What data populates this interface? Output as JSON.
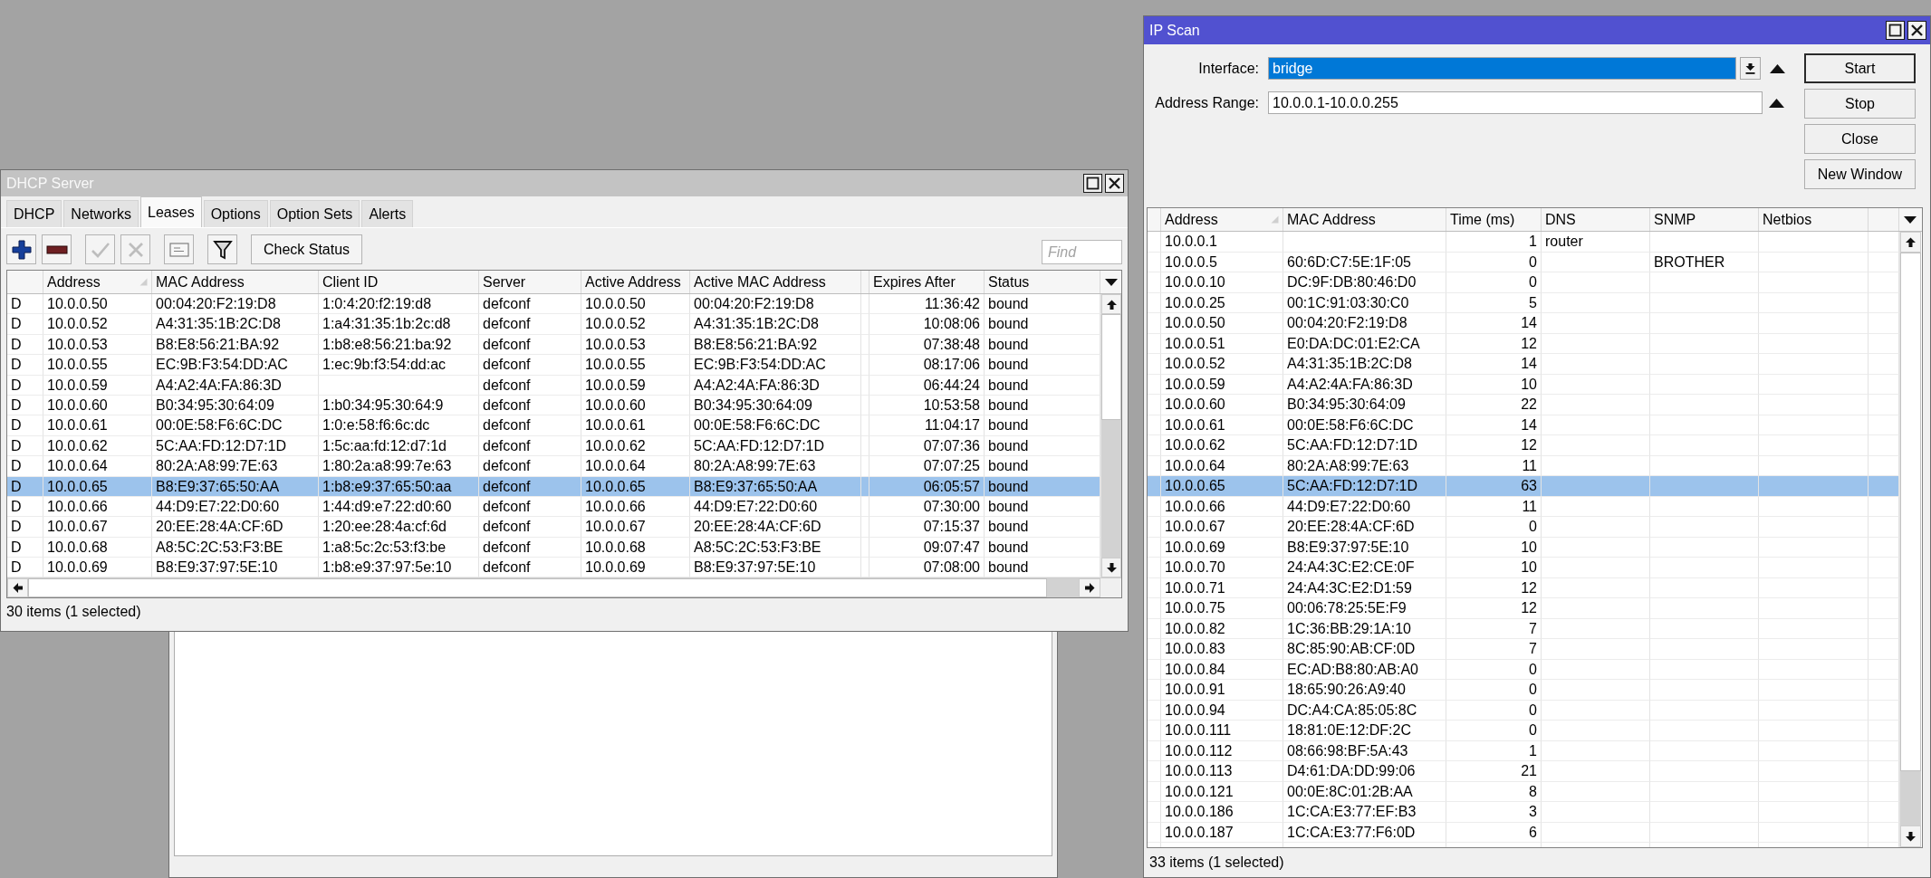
{
  "dhcp_window": {
    "title": "DHCP Server",
    "active": false,
    "tabs": [
      {
        "label": "DHCP",
        "selected": false
      },
      {
        "label": "Networks",
        "selected": false
      },
      {
        "label": "Leases",
        "selected": true
      },
      {
        "label": "Options",
        "selected": false
      },
      {
        "label": "Option Sets",
        "selected": false
      },
      {
        "label": "Alerts",
        "selected": false
      }
    ],
    "toolbar": [
      {
        "kind": "add",
        "disabled": false
      },
      {
        "kind": "remove",
        "disabled": false
      },
      {
        "kind": "enable",
        "disabled": true
      },
      {
        "kind": "disable",
        "disabled": true
      },
      {
        "kind": "comment",
        "disabled": false
      },
      {
        "kind": "filter",
        "disabled": false
      },
      {
        "kind": "text",
        "label": "Check Status",
        "disabled": false
      }
    ],
    "find": {
      "placeholder": "Find"
    },
    "table": {
      "columns": [
        {
          "label": "Address",
          "sorted": true
        },
        {
          "label": "MAC Address",
          "sorted": false
        },
        {
          "label": "Client ID",
          "sorted": false
        },
        {
          "label": "Server",
          "sorted": false
        },
        {
          "label": "Active Address",
          "sorted": false
        },
        {
          "label": "Active MAC Address",
          "sorted": false
        },
        {
          "label": "Expires After",
          "sorted": false
        },
        {
          "label": "Status",
          "sorted": false
        }
      ],
      "rows": [
        {
          "flag": "D",
          "address": "10.0.0.50",
          "mac_address": "00:04:20:F2:19:D8",
          "client_id": "1:0:4:20:f2:19:d8",
          "server": "defconf",
          "active_address": "10.0.0.50",
          "active_mac_address": "00:04:20:F2:19:D8",
          "expires_after": "11:36:42",
          "status": "bound",
          "selected": false
        },
        {
          "flag": "D",
          "address": "10.0.0.52",
          "mac_address": "A4:31:35:1B:2C:D8",
          "client_id": "1:a4:31:35:1b:2c:d8",
          "server": "defconf",
          "active_address": "10.0.0.52",
          "active_mac_address": "A4:31:35:1B:2C:D8",
          "expires_after": "10:08:06",
          "status": "bound",
          "selected": false
        },
        {
          "flag": "D",
          "address": "10.0.0.53",
          "mac_address": "B8:E8:56:21:BA:92",
          "client_id": "1:b8:e8:56:21:ba:92",
          "server": "defconf",
          "active_address": "10.0.0.53",
          "active_mac_address": "B8:E8:56:21:BA:92",
          "expires_after": "07:38:48",
          "status": "bound",
          "selected": false
        },
        {
          "flag": "D",
          "address": "10.0.0.55",
          "mac_address": "EC:9B:F3:54:DD:AC",
          "client_id": "1:ec:9b:f3:54:dd:ac",
          "server": "defconf",
          "active_address": "10.0.0.55",
          "active_mac_address": "EC:9B:F3:54:DD:AC",
          "expires_after": "08:17:06",
          "status": "bound",
          "selected": false
        },
        {
          "flag": "D",
          "address": "10.0.0.59",
          "mac_address": "A4:A2:4A:FA:86:3D",
          "server": "defconf",
          "active_address": "10.0.0.59",
          "active_mac_address": "A4:A2:4A:FA:86:3D",
          "expires_after": "06:44:24",
          "status": "bound",
          "selected": false
        },
        {
          "flag": "D",
          "address": "10.0.0.60",
          "mac_address": "B0:34:95:30:64:09",
          "client_id": "1:b0:34:95:30:64:9",
          "server": "defconf",
          "active_address": "10.0.0.60",
          "active_mac_address": "B0:34:95:30:64:09",
          "expires_after": "10:53:58",
          "status": "bound",
          "selected": false
        },
        {
          "flag": "D",
          "address": "10.0.0.61",
          "mac_address": "00:0E:58:F6:6C:DC",
          "client_id": "1:0:e:58:f6:6c:dc",
          "server": "defconf",
          "active_address": "10.0.0.61",
          "active_mac_address": "00:0E:58:F6:6C:DC",
          "expires_after": "11:04:17",
          "status": "bound",
          "selected": false
        },
        {
          "flag": "D",
          "address": "10.0.0.62",
          "mac_address": "5C:AA:FD:12:D7:1D",
          "client_id": "1:5c:aa:fd:12:d7:1d",
          "server": "defconf",
          "active_address": "10.0.0.62",
          "active_mac_address": "5C:AA:FD:12:D7:1D",
          "expires_after": "07:07:36",
          "status": "bound",
          "selected": false
        },
        {
          "flag": "D",
          "address": "10.0.0.64",
          "mac_address": "80:2A:A8:99:7E:63",
          "client_id": "1:80:2a:a8:99:7e:63",
          "server": "defconf",
          "active_address": "10.0.0.64",
          "active_mac_address": "80:2A:A8:99:7E:63",
          "expires_after": "07:07:25",
          "status": "bound",
          "selected": false
        },
        {
          "flag": "D",
          "address": "10.0.0.65",
          "mac_address": "B8:E9:37:65:50:AA",
          "client_id": "1:b8:e9:37:65:50:aa",
          "server": "defconf",
          "active_address": "10.0.0.65",
          "active_mac_address": "B8:E9:37:65:50:AA",
          "expires_after": "06:05:57",
          "status": "bound",
          "selected": true
        },
        {
          "flag": "D",
          "address": "10.0.0.66",
          "mac_address": "44:D9:E7:22:D0:60",
          "client_id": "1:44:d9:e7:22:d0:60",
          "server": "defconf",
          "active_address": "10.0.0.66",
          "active_mac_address": "44:D9:E7:22:D0:60",
          "expires_after": "07:30:00",
          "status": "bound",
          "selected": false
        },
        {
          "flag": "D",
          "address": "10.0.0.67",
          "mac_address": "20:EE:28:4A:CF:6D",
          "client_id": "1:20:ee:28:4a:cf:6d",
          "server": "defconf",
          "active_address": "10.0.0.67",
          "active_mac_address": "20:EE:28:4A:CF:6D",
          "expires_after": "07:15:37",
          "status": "bound",
          "selected": false
        },
        {
          "flag": "D",
          "address": "10.0.0.68",
          "mac_address": "A8:5C:2C:53:F3:BE",
          "client_id": "1:a8:5c:2c:53:f3:be",
          "server": "defconf",
          "active_address": "10.0.0.68",
          "active_mac_address": "A8:5C:2C:53:F3:BE",
          "expires_after": "09:07:47",
          "status": "bound",
          "selected": false
        },
        {
          "flag": "D",
          "address": "10.0.0.69",
          "mac_address": "B8:E9:37:97:5E:10",
          "client_id": "1:b8:e9:37:97:5e:10",
          "server": "defconf",
          "active_address": "10.0.0.69",
          "active_mac_address": "B8:E9:37:97:5E:10",
          "expires_after": "07:08:00",
          "status": "bound",
          "selected": false
        }
      ]
    },
    "status_bar": "30 items (1 selected)"
  },
  "ip_scan_window": {
    "title": "IP Scan",
    "active": true,
    "interface": {
      "label": "Interface:",
      "value": "bridge",
      "highlighted": true
    },
    "address_range": {
      "label": "Address Range:",
      "value": "10.0.0.1-10.0.0.255"
    },
    "buttons": [
      {
        "label": "Start",
        "default": true
      },
      {
        "label": "Stop",
        "default": false
      },
      {
        "label": "Close",
        "default": false
      },
      {
        "label": "New Window",
        "default": false
      }
    ],
    "table": {
      "columns": [
        {
          "label": "Address",
          "sorted": true
        },
        {
          "label": "MAC Address",
          "sorted": false
        },
        {
          "label": "Time (ms)",
          "sorted": false
        },
        {
          "label": "DNS",
          "sorted": false
        },
        {
          "label": "SNMP",
          "sorted": false
        },
        {
          "label": "Netbios",
          "sorted": false
        }
      ],
      "rows": [
        {
          "address": "10.0.0.1",
          "time_ms": "1",
          "dns": "router",
          "selected": false
        },
        {
          "address": "10.0.0.5",
          "mac_address": "60:6D:C7:5E:1F:05",
          "time_ms": "0",
          "snmp": "BROTHER",
          "selected": false
        },
        {
          "address": "10.0.0.10",
          "mac_address": "DC:9F:DB:80:46:D0",
          "time_ms": "0",
          "selected": false
        },
        {
          "address": "10.0.0.25",
          "mac_address": "00:1C:91:03:30:C0",
          "time_ms": "5",
          "selected": false
        },
        {
          "address": "10.0.0.50",
          "mac_address": "00:04:20:F2:19:D8",
          "time_ms": "14",
          "selected": false
        },
        {
          "address": "10.0.0.51",
          "mac_address": "E0:DA:DC:01:E2:CA",
          "time_ms": "12",
          "selected": false
        },
        {
          "address": "10.0.0.52",
          "mac_address": "A4:31:35:1B:2C:D8",
          "time_ms": "14",
          "selected": false
        },
        {
          "address": "10.0.0.59",
          "mac_address": "A4:A2:4A:FA:86:3D",
          "time_ms": "10",
          "selected": false
        },
        {
          "address": "10.0.0.60",
          "mac_address": "B0:34:95:30:64:09",
          "time_ms": "22",
          "selected": false
        },
        {
          "address": "10.0.0.61",
          "mac_address": "00:0E:58:F6:6C:DC",
          "time_ms": "14",
          "selected": false
        },
        {
          "address": "10.0.0.62",
          "mac_address": "5C:AA:FD:12:D7:1D",
          "time_ms": "12",
          "selected": false
        },
        {
          "address": "10.0.0.64",
          "mac_address": "80:2A:A8:99:7E:63",
          "time_ms": "11",
          "selected": false
        },
        {
          "address": "10.0.0.65",
          "mac_address": "5C:AA:FD:12:D7:1D",
          "time_ms": "63",
          "selected": true
        },
        {
          "address": "10.0.0.66",
          "mac_address": "44:D9:E7:22:D0:60",
          "time_ms": "11",
          "selected": false
        },
        {
          "address": "10.0.0.67",
          "mac_address": "20:EE:28:4A:CF:6D",
          "time_ms": "0",
          "selected": false
        },
        {
          "address": "10.0.0.69",
          "mac_address": "B8:E9:37:97:5E:10",
          "time_ms": "10",
          "selected": false
        },
        {
          "address": "10.0.0.70",
          "mac_address": "24:A4:3C:E2:CE:0F",
          "time_ms": "10",
          "selected": false
        },
        {
          "address": "10.0.0.71",
          "mac_address": "24:A4:3C:E2:D1:59",
          "time_ms": "12",
          "selected": false
        },
        {
          "address": "10.0.0.75",
          "mac_address": "00:06:78:25:5E:F9",
          "time_ms": "12",
          "selected": false
        },
        {
          "address": "10.0.0.82",
          "mac_address": "1C:36:BB:29:1A:10",
          "time_ms": "7",
          "selected": false
        },
        {
          "address": "10.0.0.83",
          "mac_address": "8C:85:90:AB:CF:0D",
          "time_ms": "7",
          "selected": false
        },
        {
          "address": "10.0.0.84",
          "mac_address": "EC:AD:B8:80:AB:A0",
          "time_ms": "0",
          "selected": false
        },
        {
          "address": "10.0.0.91",
          "mac_address": "18:65:90:26:A9:40",
          "time_ms": "0",
          "selected": false
        },
        {
          "address": "10.0.0.94",
          "mac_address": "DC:A4:CA:85:05:8C",
          "time_ms": "0",
          "selected": false
        },
        {
          "address": "10.0.0.111",
          "mac_address": "18:81:0E:12:DF:2C",
          "time_ms": "0",
          "selected": false
        },
        {
          "address": "10.0.0.112",
          "mac_address": "08:66:98:BF:5A:43",
          "time_ms": "1",
          "selected": false
        },
        {
          "address": "10.0.0.113",
          "mac_address": "D4:61:DA:DD:99:06",
          "time_ms": "21",
          "selected": false
        },
        {
          "address": "10.0.0.121",
          "mac_address": "00:0E:8C:01:2B:AA",
          "time_ms": "8",
          "selected": false
        },
        {
          "address": "10.0.0.186",
          "mac_address": "1C:CA:E3:77:EF:B3",
          "time_ms": "3",
          "selected": false
        },
        {
          "address": "10.0.0.187",
          "mac_address": "1C:CA:E3:77:F6:0D",
          "time_ms": "6",
          "selected": false
        }
      ]
    },
    "status_bar": "33 items (1 selected)"
  }
}
